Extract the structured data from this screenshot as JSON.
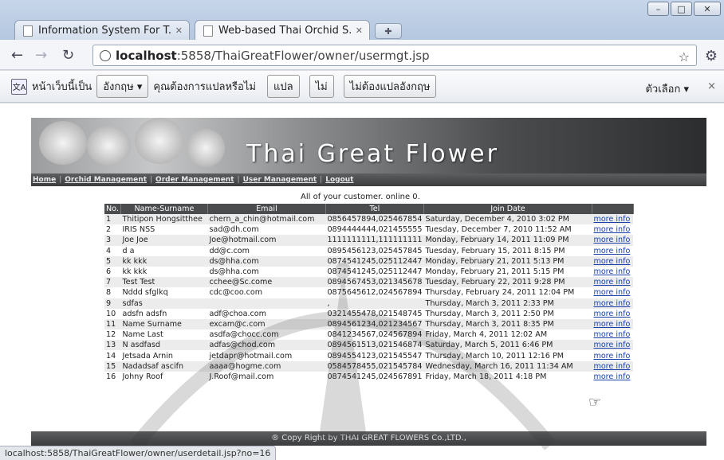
{
  "browser": {
    "tabs": [
      {
        "label": "Information System For T...",
        "active": false
      },
      {
        "label": "Web-based Thai Orchid S...",
        "active": true
      }
    ],
    "url_host": "localhost",
    "url_rest": ":5858/ThaiGreatFlower/owner/usermgt.jsp",
    "window_controls": [
      "minimize",
      "maximize",
      "close"
    ]
  },
  "translate": {
    "prefix": "หน้าเว็บนี้เป็น",
    "language": "อังกฤษ",
    "question": "คุณต้องการแปลหรือไม่",
    "translate_label": "แปล",
    "no_label": "ไม่",
    "never_label": "ไม่ต้องแปลอังกฤษ",
    "options_label": "ตัวเลือก",
    "close": "×"
  },
  "site": {
    "banner_title": "Thai Great Flower",
    "menu": [
      "Home",
      "Orchid Management",
      "Order Management",
      "User Management",
      "Logout"
    ],
    "caption": "All of your customer. online 0.",
    "footer": "® Copy Right by THAI GREAT FLOWERS Co.,LTD.,"
  },
  "table": {
    "headers": [
      "No.",
      "Name-Surname",
      "Email",
      "Tel",
      "Join Date",
      ""
    ],
    "rows": [
      {
        "no": "1",
        "name": "Thitipon Hongsitthee",
        "email": "chern_a_chin@hotmail.com",
        "tel": "0856457894,025467854",
        "date": "Saturday, December 4, 2010 3:02 PM",
        "link": "more info"
      },
      {
        "no": "2",
        "name": "IRIS NSS",
        "email": "sad@dh.com",
        "tel": "0894444444,021455555",
        "date": "Tuesday, December 7, 2010 11:52 AM",
        "link": "more info"
      },
      {
        "no": "3",
        "name": "Joe Joe",
        "email": "Joe@hotmail.com",
        "tel": "1111111111,111111111",
        "date": "Monday, February 14, 2011 11:09 PM",
        "link": "more info"
      },
      {
        "no": "4",
        "name": "d a",
        "email": "dd@c.com",
        "tel": "0895456123,025457845",
        "date": "Tuesday, February 15, 2011 8:15 PM",
        "link": "more info"
      },
      {
        "no": "5",
        "name": "kk kkk",
        "email": "ds@hha.com",
        "tel": "0874541245,025112447",
        "date": "Monday, February 21, 2011 5:13 PM",
        "link": "more info"
      },
      {
        "no": "6",
        "name": "kk kkk",
        "email": "ds@hha.com",
        "tel": "0874541245,025112447",
        "date": "Monday, February 21, 2011 5:15 PM",
        "link": "more info"
      },
      {
        "no": "7",
        "name": "Test Test",
        "email": "cchee@Sc.come",
        "tel": "0894567453,021345678",
        "date": "Tuesday, February 22, 2011 9:28 PM",
        "link": "more info"
      },
      {
        "no": "8",
        "name": "Nddd sfglkq",
        "email": "cdc@coo.com",
        "tel": "0875645612,024567894",
        "date": "Thursday, February 24, 2011 12:04 PM",
        "link": "more info"
      },
      {
        "no": "9",
        "name": "sdfas",
        "email": "",
        "tel": ",",
        "date": "Thursday, March 3, 2011 2:33 PM",
        "link": "more info"
      },
      {
        "no": "10",
        "name": "adsfn adsfn",
        "email": "adf@choa.com",
        "tel": "0321455478,021548745",
        "date": "Thursday, March 3, 2011 2:50 PM",
        "link": "more info"
      },
      {
        "no": "11",
        "name": "Name Surname",
        "email": "excam@c.com",
        "tel": "0894561234,021234567",
        "date": "Thursday, March 3, 2011 8:35 PM",
        "link": "more info"
      },
      {
        "no": "12",
        "name": "Name Last",
        "email": "asdfa@chocc.com",
        "tel": "0841234567,024567894",
        "date": "Friday, March 4, 2011 12:02 AM",
        "link": "more info"
      },
      {
        "no": "13",
        "name": "N asdfasd",
        "email": "adfas@chod.com",
        "tel": "0894561513,021546874",
        "date": "Saturday, March 5, 2011 6:46 PM",
        "link": "more info"
      },
      {
        "no": "14",
        "name": "Jetsada Arnin",
        "email": "jetdapr@hotmail.com",
        "tel": "0894554123,021545547",
        "date": "Thursday, March 10, 2011 12:16 PM",
        "link": "more info"
      },
      {
        "no": "15",
        "name": "Nadadsaf ascifn",
        "email": "aaaa@hogme.com",
        "tel": "0584578455,021545784",
        "date": "Wednesday, March 16, 2011 11:34 AM",
        "link": "more info"
      },
      {
        "no": "16",
        "name": "Johny Roof",
        "email": "J.Roof@mail.com",
        "tel": "0874541245,024567891",
        "date": "Friday, March 18, 2011 4:18 PM",
        "link": "more info"
      }
    ]
  },
  "status_url": "localhost:5858/ThaiGreatFlower/owner/userdetail.jsp?no=16"
}
